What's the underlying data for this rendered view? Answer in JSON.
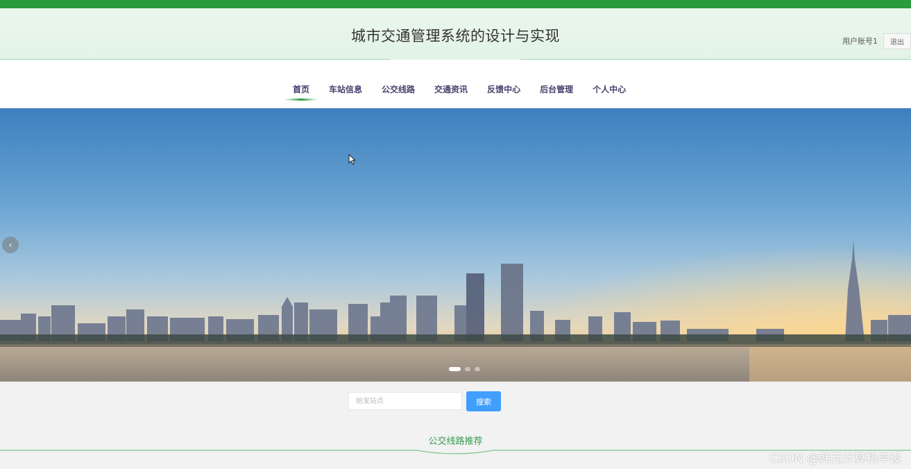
{
  "header": {
    "title": "城市交通管理系统的设计与实现",
    "user_label": "用户账号1",
    "logout_label": "退出"
  },
  "nav": {
    "items": [
      {
        "label": "首页",
        "active": true
      },
      {
        "label": "车站信息"
      },
      {
        "label": "公交线路"
      },
      {
        "label": "交通资讯"
      },
      {
        "label": "反馈中心"
      },
      {
        "label": "后台管理"
      },
      {
        "label": "个人中心"
      }
    ]
  },
  "banner": {
    "prev_icon": "chevron-left-icon",
    "slides_total": 3,
    "active_slide": 1
  },
  "search": {
    "placeholder": "始发站点",
    "button_label": "搜索"
  },
  "section": {
    "title": "公交线路推荐"
  },
  "watermark": "CSDN @韩元计算机毕设",
  "colors": {
    "topbar": "#2a9a3e",
    "header_bg": "#e6f4e9",
    "accent_green": "#3a9a4e",
    "search_button": "#409eff",
    "nav_text": "#4a3f6b"
  }
}
